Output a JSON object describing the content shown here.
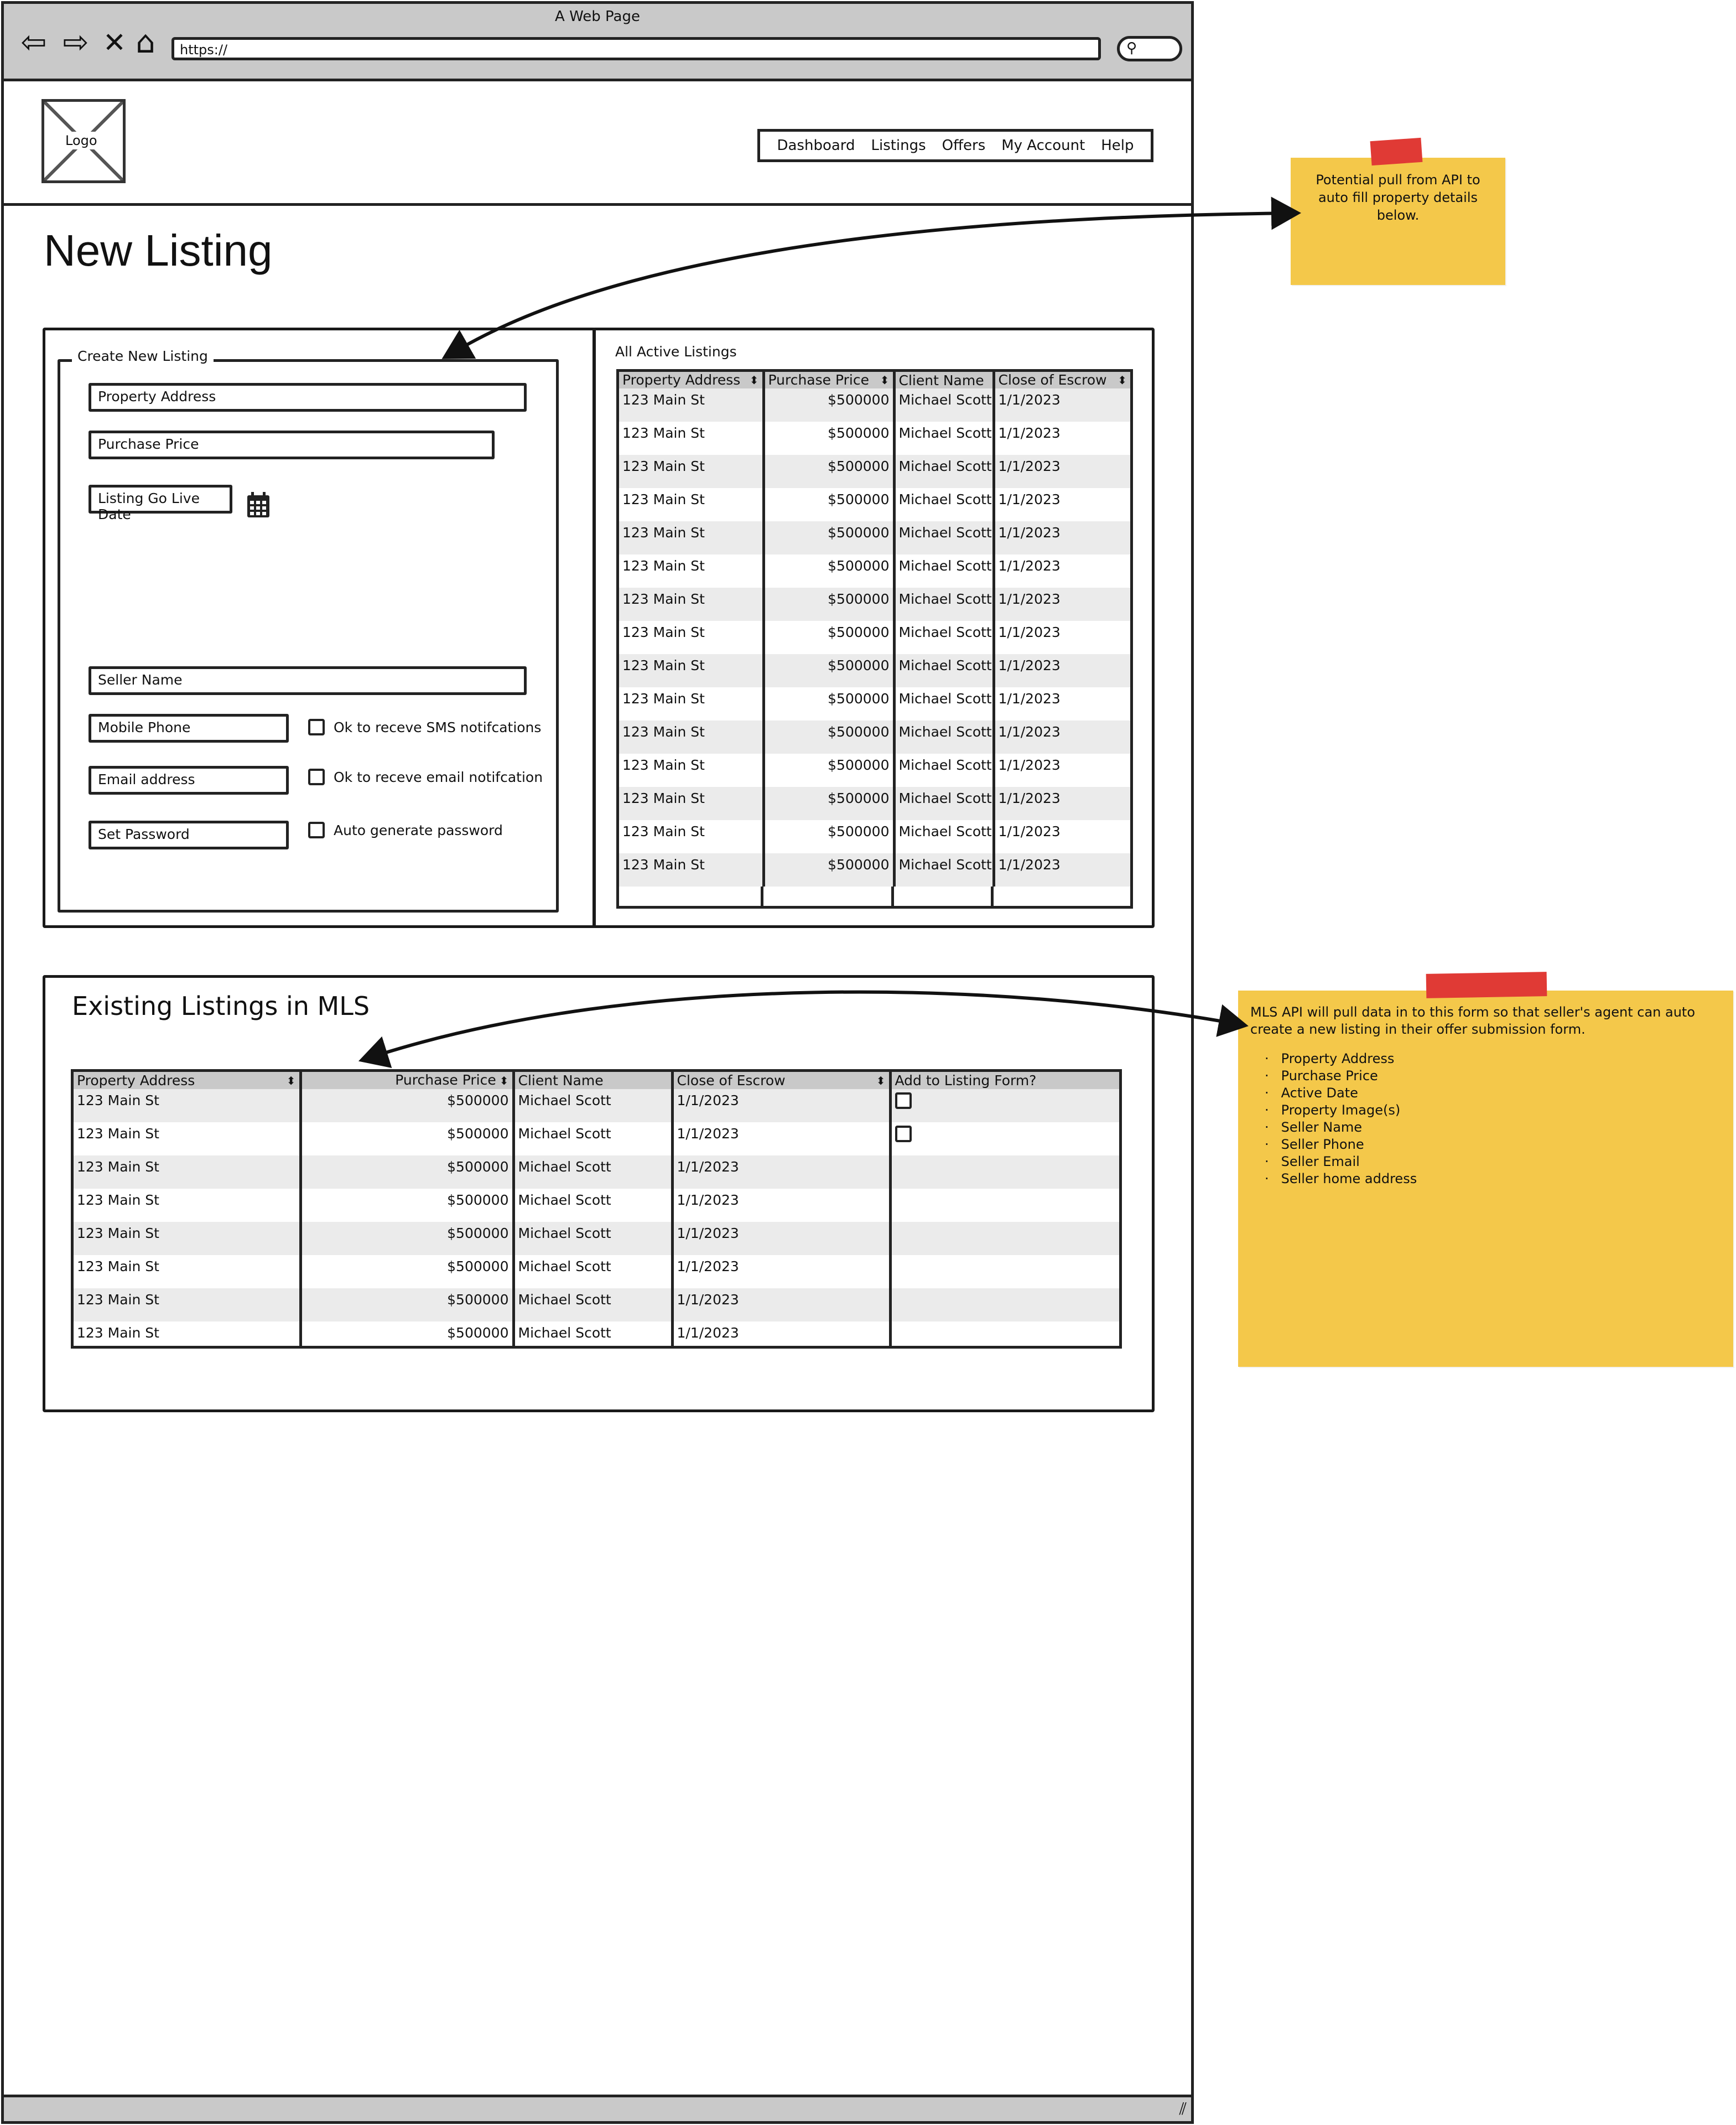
{
  "browser": {
    "window_title": "A Web Page",
    "url": "https://",
    "nav_icons": [
      "back-icon",
      "forward-icon",
      "stop-icon",
      "home-icon"
    ],
    "search_icon": "search-icon"
  },
  "header": {
    "logo_label": "Logo",
    "nav": [
      "Dashboard",
      "Listings",
      "Offers",
      "My Account",
      "Help"
    ]
  },
  "page": {
    "title": "New Listing"
  },
  "create_form": {
    "legend": "Create New Listing",
    "property_address": "Property Address",
    "purchase_price": "Purchase Price",
    "listing_go_live_date": "Listing Go Live Date",
    "calendar_icon": "calendar-icon",
    "seller_name": "Seller Name",
    "mobile_phone": "Mobile Phone",
    "sms_opt_in": "Ok to receve SMS notifcations",
    "email_address": "Email address",
    "email_opt_in": "Ok to receve email notifcation",
    "set_password": "Set Password",
    "auto_password": "Auto generate password"
  },
  "active_listings": {
    "label": "All Active Listings",
    "columns": [
      "Property Address",
      "Purchase Price",
      "Client Name",
      "Close of Escrow"
    ],
    "rows": [
      [
        "123 Main St",
        "$500000",
        "Michael Scott",
        "1/1/2023"
      ],
      [
        "123 Main St",
        "$500000",
        "Michael Scott",
        "1/1/2023"
      ],
      [
        "123 Main St",
        "$500000",
        "Michael Scott",
        "1/1/2023"
      ],
      [
        "123 Main St",
        "$500000",
        "Michael Scott",
        "1/1/2023"
      ],
      [
        "123 Main St",
        "$500000",
        "Michael Scott",
        "1/1/2023"
      ],
      [
        "123 Main St",
        "$500000",
        "Michael Scott",
        "1/1/2023"
      ],
      [
        "123 Main St",
        "$500000",
        "Michael Scott",
        "1/1/2023"
      ],
      [
        "123 Main St",
        "$500000",
        "Michael Scott",
        "1/1/2023"
      ],
      [
        "123 Main St",
        "$500000",
        "Michael Scott",
        "1/1/2023"
      ],
      [
        "123 Main St",
        "$500000",
        "Michael Scott",
        "1/1/2023"
      ],
      [
        "123 Main St",
        "$500000",
        "Michael Scott",
        "1/1/2023"
      ],
      [
        "123 Main St",
        "$500000",
        "Michael Scott",
        "1/1/2023"
      ],
      [
        "123 Main St",
        "$500000",
        "Michael Scott",
        "1/1/2023"
      ],
      [
        "123 Main St",
        "$500000",
        "Michael Scott",
        "1/1/2023"
      ],
      [
        "123 Main St",
        "$500000",
        "Michael Scott",
        "1/1/2023"
      ]
    ]
  },
  "mls_listings": {
    "title": "Existing Listings in MLS",
    "columns": [
      "Property Address",
      "Purchase Price",
      "Client Name",
      "Close of Escrow",
      "Add to Listing Form?"
    ],
    "rows": [
      [
        "123 Main St",
        "$500000",
        "Michael Scott",
        "1/1/2023"
      ],
      [
        "123 Main St",
        "$500000",
        "Michael Scott",
        "1/1/2023"
      ],
      [
        "123 Main St",
        "$500000",
        "Michael Scott",
        "1/1/2023"
      ],
      [
        "123 Main St",
        "$500000",
        "Michael Scott",
        "1/1/2023"
      ],
      [
        "123 Main St",
        "$500000",
        "Michael Scott",
        "1/1/2023"
      ],
      [
        "123 Main St",
        "$500000",
        "Michael Scott",
        "1/1/2023"
      ],
      [
        "123 Main St",
        "$500000",
        "Michael Scott",
        "1/1/2023"
      ],
      [
        "123 Main St",
        "$500000",
        "Michael Scott",
        "1/1/2023"
      ]
    ],
    "checkbox_rows": 2
  },
  "notes": {
    "note1": "Potential pull from API to auto fill property details below.",
    "note2_intro": "MLS API will pull data in to this form so that seller's agent can auto create a new listing in their offer submission form.",
    "note2_items": [
      "Property Address",
      "Purchase Price",
      "Active Date",
      "Property Image(s)",
      "Seller Name",
      "Seller Phone",
      "Seller Email",
      "Seller home address"
    ]
  },
  "colors": {
    "sticky": "#f4c84a",
    "tape": "#e03a35",
    "chrome": "#c9c9c9",
    "row_alt": "#ebebeb"
  }
}
